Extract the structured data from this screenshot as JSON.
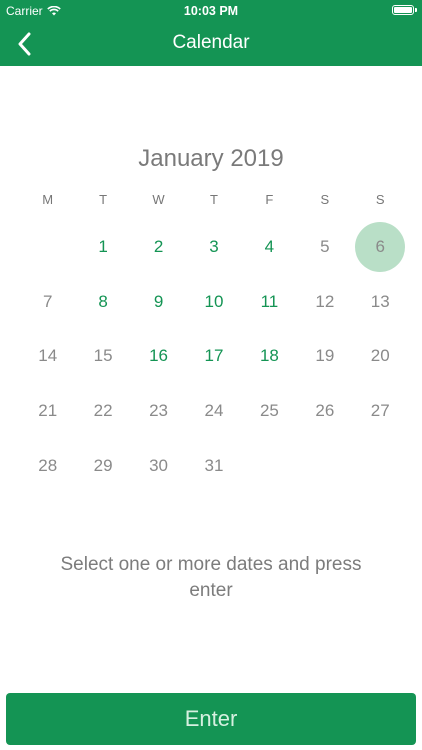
{
  "status_bar": {
    "carrier": "Carrier",
    "time": "10:03 PM"
  },
  "nav": {
    "title": "Calendar"
  },
  "calendar": {
    "month": "January 2019",
    "weekdays": [
      "M",
      "T",
      "W",
      "T",
      "F",
      "S",
      "S"
    ],
    "leading_blanks": 1,
    "days": [
      {
        "label": "1",
        "available": true
      },
      {
        "label": "2",
        "available": true
      },
      {
        "label": "3",
        "available": true
      },
      {
        "label": "4",
        "available": true
      },
      {
        "label": "5",
        "available": false
      },
      {
        "label": "6",
        "available": false,
        "today": true
      },
      {
        "label": "7",
        "available": false
      },
      {
        "label": "8",
        "available": true
      },
      {
        "label": "9",
        "available": true
      },
      {
        "label": "10",
        "available": true
      },
      {
        "label": "11",
        "available": true
      },
      {
        "label": "12",
        "available": false
      },
      {
        "label": "13",
        "available": false
      },
      {
        "label": "14",
        "available": false
      },
      {
        "label": "15",
        "available": false
      },
      {
        "label": "16",
        "available": true
      },
      {
        "label": "17",
        "available": true
      },
      {
        "label": "18",
        "available": true
      },
      {
        "label": "19",
        "available": false
      },
      {
        "label": "20",
        "available": false
      },
      {
        "label": "21",
        "available": false
      },
      {
        "label": "22",
        "available": false
      },
      {
        "label": "23",
        "available": false
      },
      {
        "label": "24",
        "available": false
      },
      {
        "label": "25",
        "available": false
      },
      {
        "label": "26",
        "available": false
      },
      {
        "label": "27",
        "available": false
      },
      {
        "label": "28",
        "available": false
      },
      {
        "label": "29",
        "available": false
      },
      {
        "label": "30",
        "available": false
      },
      {
        "label": "31",
        "available": false
      }
    ]
  },
  "instructions": "Select one or more dates and press enter",
  "enter_button": {
    "label": "Enter"
  },
  "colors": {
    "brand_green": "#149454",
    "today_highlight": "#b9dfc7",
    "inactive_text": "#8a8a8a"
  }
}
